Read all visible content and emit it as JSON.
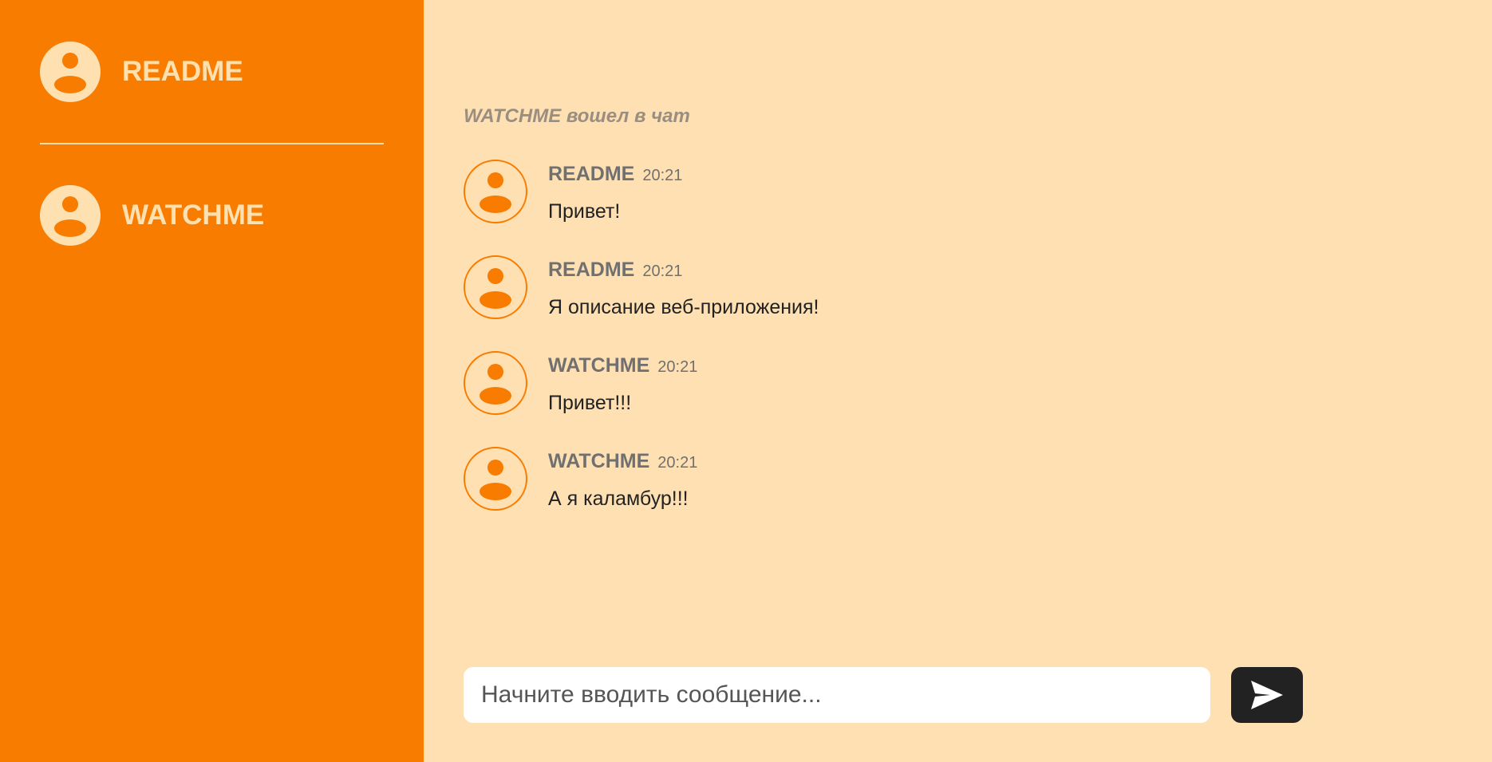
{
  "colors": {
    "sidebar_bg": "#f77c00",
    "main_bg": "#ffe0b2",
    "accent": "#f77c00",
    "sidebar_text": "#ffe0b0",
    "send_button_bg": "#222222"
  },
  "sidebar": {
    "users": [
      {
        "name": "README",
        "icon": "user-avatar-icon"
      },
      {
        "name": "WATCHME",
        "icon": "user-avatar-icon"
      }
    ]
  },
  "chat": {
    "system_message": "WATCHME вошел в чат",
    "messages": [
      {
        "author": "README",
        "time": "20:21",
        "text": "Привет!"
      },
      {
        "author": "README",
        "time": "20:21",
        "text": "Я описание веб-приложения!"
      },
      {
        "author": "WATCHME",
        "time": "20:21",
        "text": "Привет!!!"
      },
      {
        "author": "WATCHME",
        "time": "20:21",
        "text": "А я каламбур!!!"
      }
    ]
  },
  "composer": {
    "placeholder": "Начните вводить сообщение...",
    "value": "",
    "send_icon": "send-icon"
  }
}
